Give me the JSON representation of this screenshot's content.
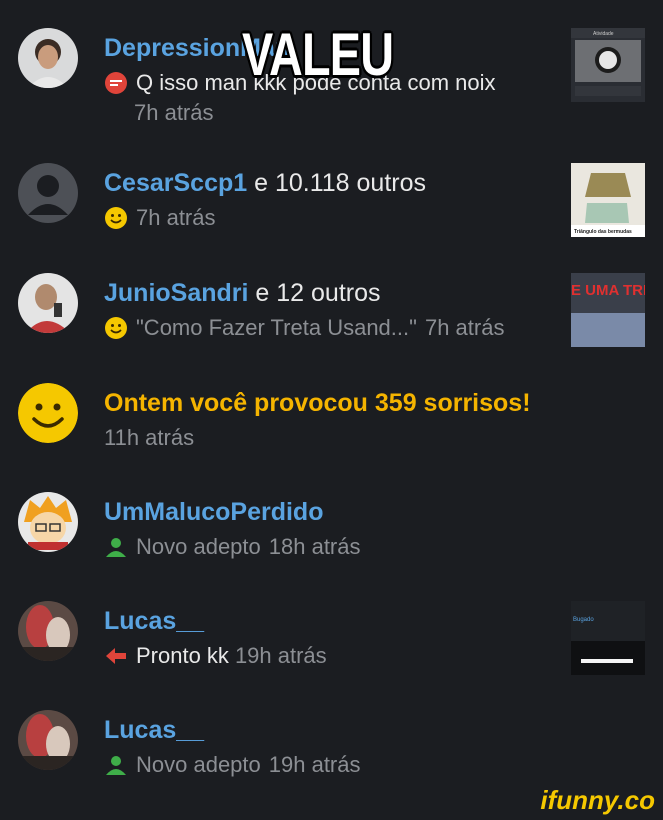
{
  "meme_caption": "VALEU",
  "notifications": [
    {
      "user": "DepressionMan",
      "suffix": "",
      "message": "Q isso man kkk pode conta com noix",
      "time": "7h atrás",
      "type": "comment",
      "thumb_label": "Atividade"
    },
    {
      "user": "CesarSccp1",
      "suffix": " e 10.118 outros",
      "message": "",
      "time": "7h atrás",
      "type": "smile",
      "thumb_label": "Triângulo das bermudas"
    },
    {
      "user": "JunioSandri",
      "suffix": " e 12 outros",
      "message": "\"Como Fazer Treta Usand...\"",
      "time": "7h atrás",
      "type": "smile",
      "thumb_label": "E UMA TRE AQUI"
    },
    {
      "user": "",
      "suffix": "Ontem você provocou 359 sorrisos!",
      "message": "",
      "time": "11h atrás",
      "type": "milestone",
      "thumb_label": ""
    },
    {
      "user": "UmMalucoPerdido",
      "suffix": "",
      "message": "",
      "sub": "Novo adepto",
      "time": "18h atrás",
      "type": "follower",
      "thumb_label": ""
    },
    {
      "user": "Lucas__",
      "suffix": "",
      "message": "Pronto kk",
      "time": "19h atrás",
      "type": "reply",
      "thumb_label": "Bugado"
    },
    {
      "user": "Lucas__",
      "suffix": "",
      "message": "",
      "sub": "Novo adepto",
      "time": "19h atrás",
      "type": "follower",
      "thumb_label": ""
    }
  ],
  "colors": {
    "background": "#1b1d21",
    "username": "#5aa3e0",
    "highlight": "#f5b400",
    "muted": "#8c8f94",
    "follower_icon": "#3fae49",
    "reply_icon": "#e0443a",
    "comment_icon": "#e0443a"
  },
  "watermark": "ifunny.co"
}
